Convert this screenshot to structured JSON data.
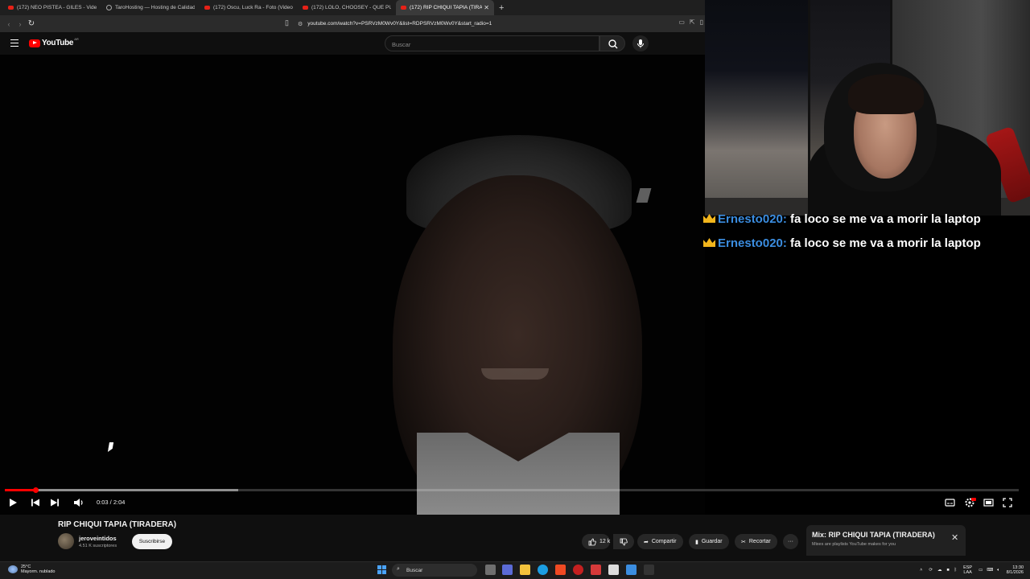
{
  "browser": {
    "tabs": [
      {
        "title": "(172) NEO PISTEA - GILES - Video O",
        "icon": "youtube-icon"
      },
      {
        "title": "TaroHosting — Hosting de Calidad",
        "icon": "globe-icon"
      },
      {
        "title": "(172) Oscu, Luck Ra - Foto (Video O",
        "icon": "youtube-icon"
      },
      {
        "title": "(172) LOLO, CHOOSEY - QUÉ PUEDE",
        "icon": "youtube-icon"
      },
      {
        "title": "(172) RIP CHIQUI TAPIA (TIRA",
        "icon": "youtube-icon"
      }
    ],
    "url": "youtube.com/watch?v=PSRVzM0Wv0Y&list=RDPSRVzM0Wv0Y&start_radio=1"
  },
  "youtube": {
    "logo_text": "YouTube",
    "logo_country": "AR",
    "search_placeholder": "Buscar"
  },
  "player": {
    "time_current": "0:03",
    "time_total": "2:04",
    "time_display": "0:03 / 2:04",
    "played_fraction": 0.03,
    "buffered_fraction": 0.23
  },
  "video": {
    "title": "RIP CHIQUI TAPIA (TIRADERA)",
    "channel": "jeroveintidos",
    "subscribers": "4.51 K suscriptores",
    "subscribe_label": "Suscribirse",
    "likes": "12 k",
    "share_label": "Compartir",
    "save_label": "Guardar",
    "clip_label": "Recortar"
  },
  "mix": {
    "title": "Mix: RIP CHIQUI TAPIA (TIRADERA)",
    "subtitle": "Mixes are playlists YouTube makes for you"
  },
  "chat": [
    {
      "user": "Ernesto020:",
      "message": "fa loco se me va a morir la laptop"
    },
    {
      "user": "Ernesto020:",
      "message": "fa loco se me va a morir la laptop"
    }
  ],
  "taskbar": {
    "weather_temp": "25°C",
    "weather_desc": "Mayorm. nublado",
    "search_label": "Buscar",
    "lang_top": "ESP",
    "lang_bottom": "LAA",
    "time": "13:30",
    "date": "8/1/2026"
  },
  "colors": {
    "accent": "#ff0000",
    "chat_user": "#3b8de0",
    "crown": "#f2b51c"
  }
}
